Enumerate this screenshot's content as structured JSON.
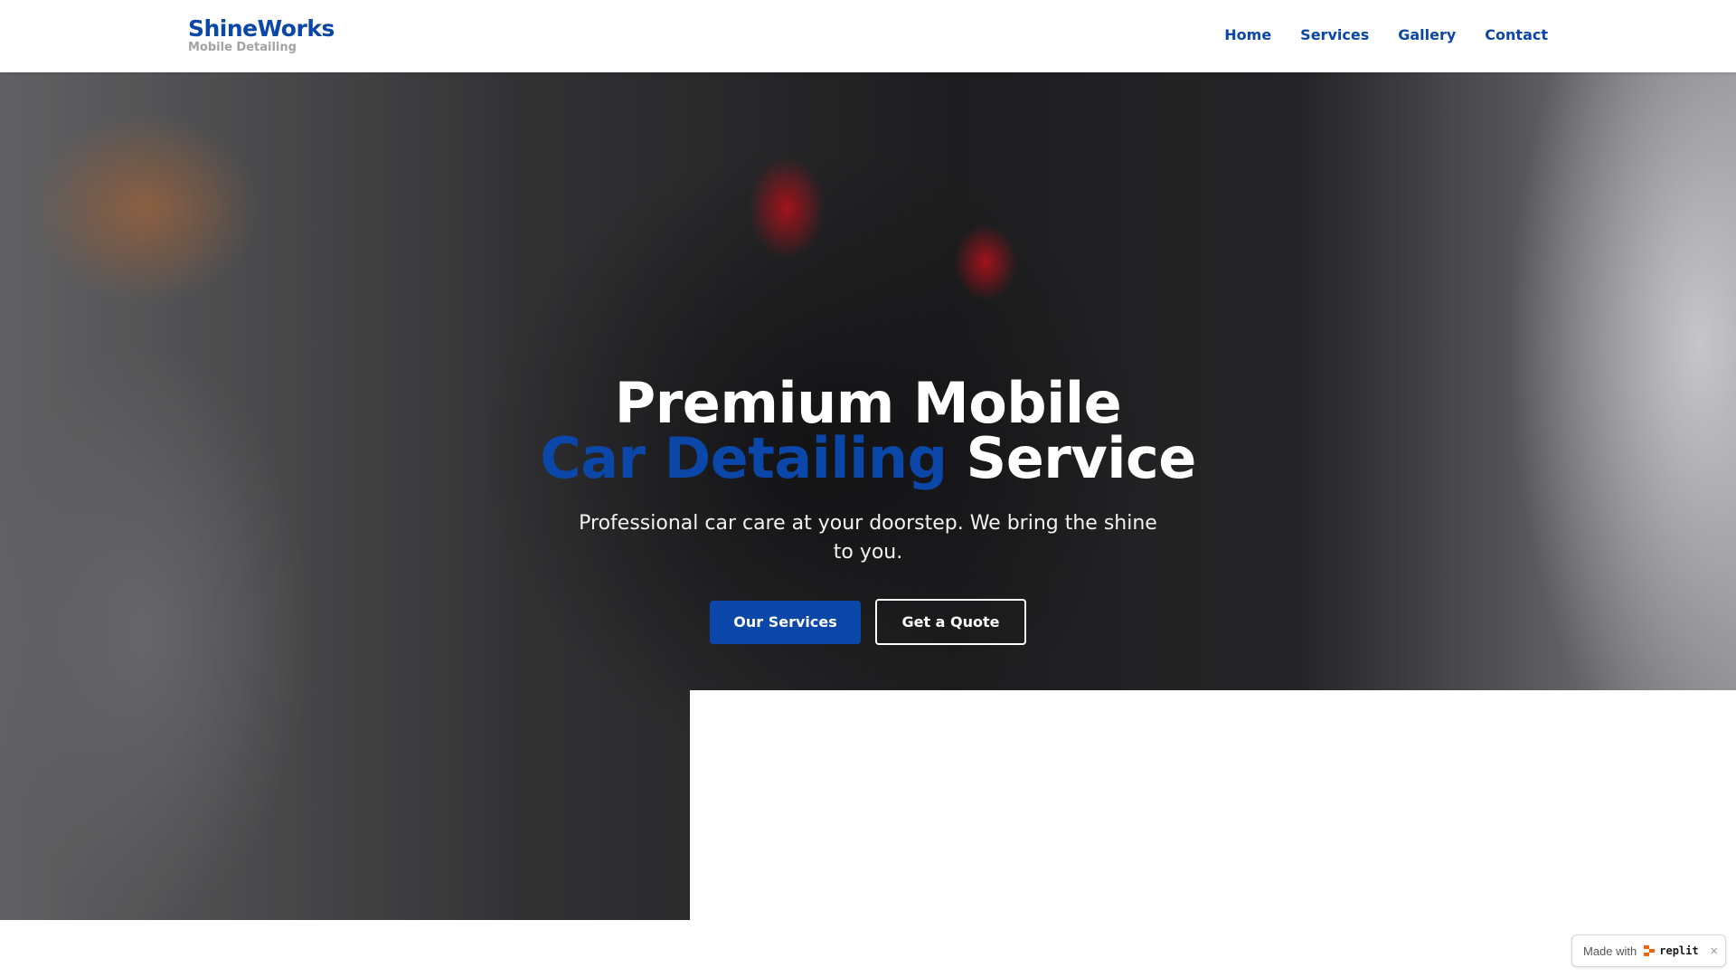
{
  "header": {
    "brand_name": "ShineWorks",
    "brand_tagline": "Mobile Detailing",
    "nav": [
      {
        "label": "Home"
      },
      {
        "label": "Services"
      },
      {
        "label": "Gallery"
      },
      {
        "label": "Contact"
      }
    ]
  },
  "hero": {
    "title_line1": "Premium Mobile",
    "title_accent": "Car Detailing",
    "title_rest": " Service",
    "subtitle": "Professional car care at your doorstep. We bring the shine to you.",
    "primary_button": "Our Services",
    "secondary_button": "Get a Quote"
  },
  "badge": {
    "made_with": "Made with",
    "brand": "replit",
    "close": "×"
  },
  "colors": {
    "brand_blue": "#0b47a8",
    "tagline_gray": "#a3a3a3",
    "replit_orange": "#f26207"
  }
}
